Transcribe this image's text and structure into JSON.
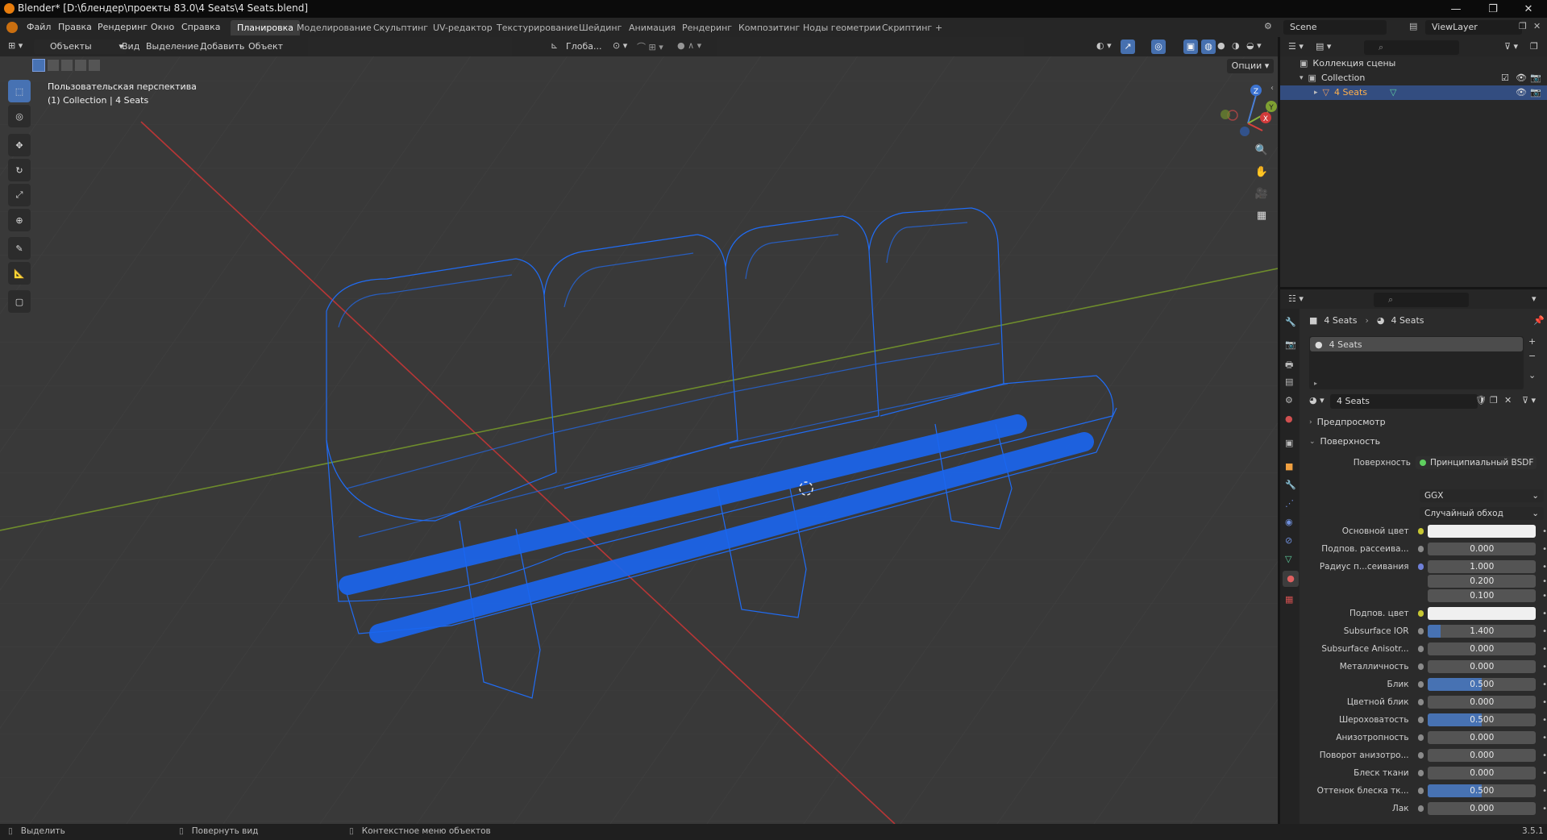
{
  "window": {
    "title": "Blender* [D:\\блендер\\проекты 83.0\\4 Seats\\4 Seats.blend]"
  },
  "menu": [
    "Файл",
    "Правка",
    "Рендеринг",
    "Окно",
    "Справка"
  ],
  "workspaces": [
    "Планировка",
    "Моделирование",
    "Скульптинг",
    "UV-редактор",
    "Текстурирование",
    "Шейдинг",
    "Анимация",
    "Рендеринг",
    "Композитинг",
    "Ноды геометрии",
    "Скриптинг"
  ],
  "workspace_add": "+",
  "scene": {
    "label": "Scene",
    "viewlayer": "ViewLayer"
  },
  "viewport": {
    "mode": "Объекты",
    "header_menu": [
      "Вид",
      "Выделение",
      "Добавить",
      "Объект"
    ],
    "transform_orientation": "Глоба...",
    "options": "Опции",
    "overlay_title": "Пользовательская перспектива",
    "overlay_subtitle": "(1) Collection | 4 Seats",
    "gizmo": {
      "x": "X",
      "y": "Y",
      "z": "Z"
    }
  },
  "outliner": {
    "root": "Коллекция сцены",
    "collection": "Collection",
    "object": "4 Seats"
  },
  "properties": {
    "breadcrumb": [
      "4 Seats",
      "4 Seats"
    ],
    "slot": "4 Seats",
    "material_name": "4 Seats",
    "preview_label": "Предпросмотр",
    "surface_section": "Поверхность",
    "surface_label": "Поверхность",
    "surface_value": "Принципиальный BSDF",
    "distribution": "GGX",
    "subsurface_method": "Случайный обход",
    "rows": [
      {
        "label": "Основной цвет",
        "value": "",
        "kind": "color"
      },
      {
        "label": "Подпов. рассеива...",
        "value": "0.000",
        "fill": 0
      },
      {
        "label": "Радиус п...сеивания",
        "value": "1.000",
        "fill": 0,
        "dot": "blue"
      },
      {
        "label": "",
        "value": "0.200",
        "fill": 0,
        "nodot": true
      },
      {
        "label": "",
        "value": "0.100",
        "fill": 0,
        "nodot": true
      },
      {
        "label": "Подпов. цвет",
        "value": "",
        "kind": "color"
      },
      {
        "label": "Subsurface IOR",
        "value": "1.400",
        "fill": 0.12
      },
      {
        "label": "Subsurface Anisotr...",
        "value": "0.000",
        "fill": 0
      },
      {
        "label": "Металличность",
        "value": "0.000",
        "fill": 0
      },
      {
        "label": "Блик",
        "value": "0.500",
        "fill": 0.5
      },
      {
        "label": "Цветной блик",
        "value": "0.000",
        "fill": 0
      },
      {
        "label": "Шероховатость",
        "value": "0.500",
        "fill": 0.5
      },
      {
        "label": "Анизотропность",
        "value": "0.000",
        "fill": 0
      },
      {
        "label": "Поворот анизотро...",
        "value": "0.000",
        "fill": 0
      },
      {
        "label": "Блеск ткани",
        "value": "0.000",
        "fill": 0
      },
      {
        "label": "Оттенок блеска тк...",
        "value": "0.500",
        "fill": 0.5
      },
      {
        "label": "Лак",
        "value": "0.000",
        "fill": 0
      }
    ]
  },
  "statusbar": {
    "items": [
      "Выделить",
      "Повернуть вид",
      "Контекстное меню объектов"
    ],
    "version": "3.5.1"
  },
  "colors": {
    "accent": "#4772b3",
    "wire": "#1f6fff",
    "xaxis": "#c83a3a",
    "yaxis": "#7fa032"
  }
}
